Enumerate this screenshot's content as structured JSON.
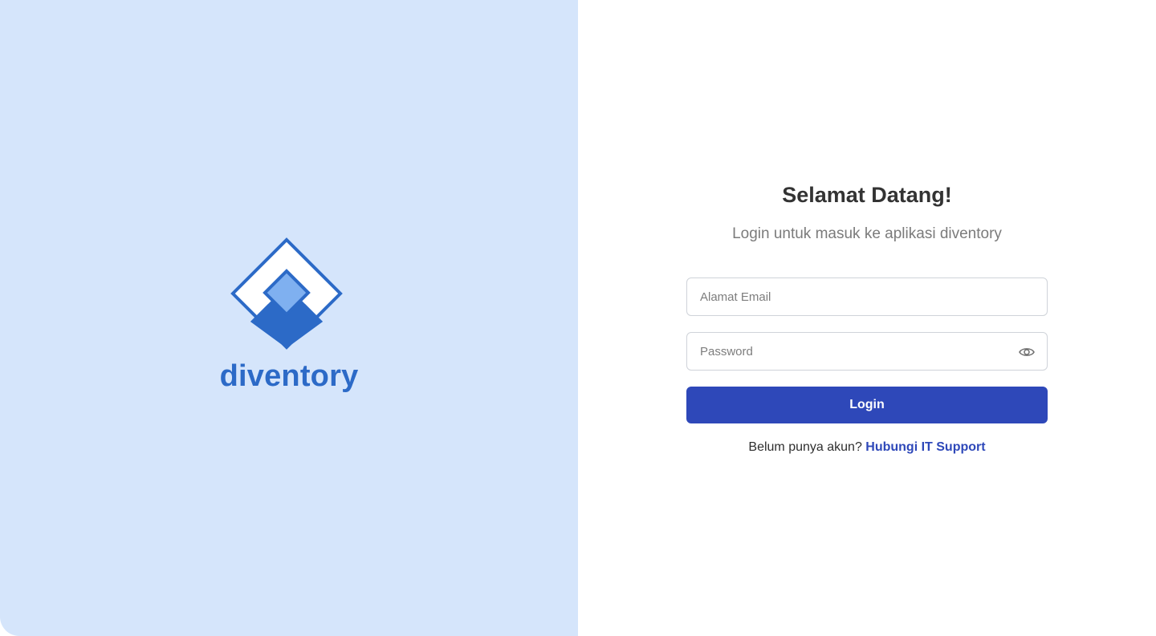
{
  "brand": {
    "name": "diventory",
    "logo_icon": "diamond-logo-icon",
    "colors": {
      "panel_bg": "#d5e5fb",
      "primary": "#2c6ac7",
      "accent_light": "#7fb0f0"
    }
  },
  "login_form": {
    "title": "Selamat Datang!",
    "subtitle": "Login untuk masuk ke aplikasi diventory",
    "email": {
      "placeholder": "Alamat Email",
      "value": ""
    },
    "password": {
      "placeholder": "Password",
      "value": "",
      "toggle_icon": "eye-icon"
    },
    "submit_label": "Login",
    "signup_prompt": "Belum punya akun?",
    "signup_link": "Hubungi IT Support",
    "colors": {
      "button": "#2e48b9",
      "link": "#2e48b9"
    }
  }
}
